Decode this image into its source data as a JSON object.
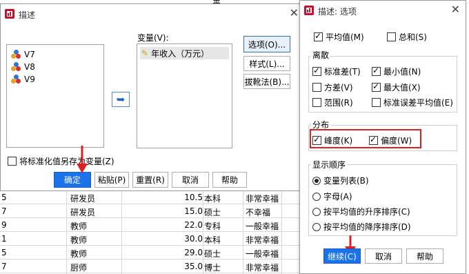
{
  "sheet": {
    "top_fragment": "金",
    "rows": [
      {
        "c0": "5",
        "c1": "研发员",
        "c2": "10.5",
        "c3": "本科",
        "c4": "非常幸福"
      },
      {
        "c0": "7",
        "c1": "研发员",
        "c2": "15.0",
        "c3": "硕士",
        "c4": "不幸福"
      },
      {
        "c0": "9",
        "c1": "教师",
        "c2": "22.0",
        "c3": "专科",
        "c4": "一般幸福"
      },
      {
        "c0": "1",
        "c1": "教师",
        "c2": "30.0",
        "c3": "本科",
        "c4": "非常幸福"
      },
      {
        "c0": "5",
        "c1": "教师",
        "c2": "29.0",
        "c3": "硕士",
        "c4": "一般幸福"
      },
      {
        "c0": "7",
        "c1": "厨师",
        "c2": "35.0",
        "c3": "博士",
        "c4": "非常幸福"
      }
    ]
  },
  "main_dialog": {
    "title": "描述",
    "source_vars": [
      "V7",
      "V8",
      "V9"
    ],
    "variables_label": "变量(V):",
    "selected_var": "年收入（万元）",
    "buttons_right": [
      "选项(O)...",
      "样式(L)...",
      "拔靴法(B)..."
    ],
    "save_standardized": "将标准化值另存为变量(Z)",
    "bottom_buttons": [
      "确定",
      "粘贴(P)",
      "重置(R)",
      "取消",
      "帮助"
    ]
  },
  "options_dialog": {
    "title": "描述: 选项",
    "mean": {
      "label": "平均值(M)",
      "checked": true
    },
    "sum": {
      "label": "总和(S)",
      "checked": false
    },
    "dispersion": {
      "title": "离散",
      "items": [
        {
          "label": "标准差(T)",
          "checked": true
        },
        {
          "label": "最小值(N)",
          "checked": true
        },
        {
          "label": "方差(V)",
          "checked": false
        },
        {
          "label": "最大值(X)",
          "checked": true
        },
        {
          "label": "范围(R)",
          "checked": false
        },
        {
          "label": "标准误差平均值(E)",
          "checked": false
        }
      ]
    },
    "distribution": {
      "title": "分布",
      "items": [
        {
          "label": "峰度(K)",
          "checked": true
        },
        {
          "label": "偏度(W)",
          "checked": true
        }
      ]
    },
    "display_order": {
      "title": "显示顺序",
      "items": [
        {
          "label": "变量列表(B)",
          "selected": true
        },
        {
          "label": "字母(A)",
          "selected": false
        },
        {
          "label": "按平均值的升序排序(C)",
          "selected": false
        },
        {
          "label": "按平均值的降序排序(D)",
          "selected": false
        }
      ]
    },
    "buttons": [
      "继续(C)",
      "取消",
      "帮助"
    ]
  },
  "colors": {
    "accent": "#1a73e8",
    "highlight": "#e02020"
  }
}
